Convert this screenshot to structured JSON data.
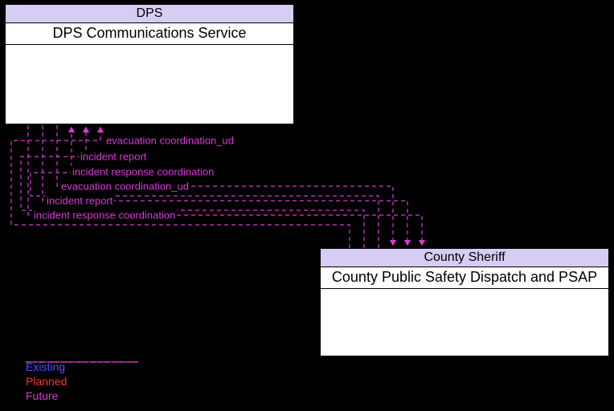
{
  "entity_top": {
    "header": "DPS",
    "title": "DPS Communications Service"
  },
  "entity_bottom": {
    "header": "County Sheriff",
    "title": "County Public Safety Dispatch and PSAP"
  },
  "flows": [
    {
      "label": "evacuation coordination_ud"
    },
    {
      "label": "incident report"
    },
    {
      "label": "incident response coordination"
    },
    {
      "label": "evacuation coordination_ud"
    },
    {
      "label": "incident report"
    },
    {
      "label": "incident response coordination"
    }
  ],
  "legend": {
    "existing": "Existing",
    "planned": "Planned",
    "future": "Future"
  }
}
